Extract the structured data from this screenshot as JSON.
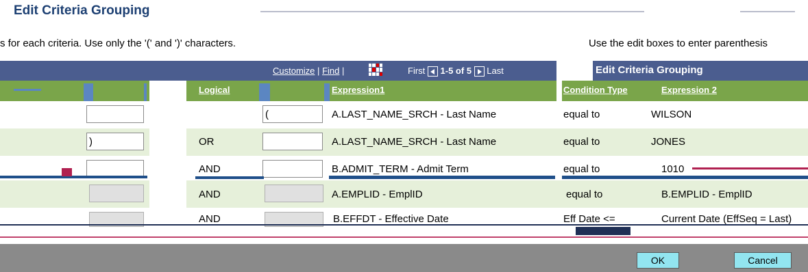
{
  "page": {
    "title": "Edit Criteria Grouping"
  },
  "instructions": {
    "left": "s for each criteria. Use only the '(' and ')' characters.",
    "right": "Use the edit boxes to enter parenthesis"
  },
  "navigation": {
    "customize_label": "Customize",
    "separator": "|",
    "find_label": "Find",
    "first_label": "First",
    "range_label": "1-5 of 5",
    "last_label": "Last"
  },
  "side_panel": {
    "title": "Edit Criteria Grouping"
  },
  "columns": {
    "logical": "Logical",
    "expression1": "Expression1",
    "condition_type": "Condition Type",
    "expression2": "Expression 2"
  },
  "rows": [
    {
      "open_paren": "",
      "logical": "",
      "close_paren": "(",
      "expression1": "A.LAST_NAME_SRCH - Last Name",
      "condition": "equal to",
      "expression2": "WILSON"
    },
    {
      "open_paren": ")",
      "logical": "OR",
      "close_paren": "",
      "expression1": "A.LAST_NAME_SRCH - Last Name",
      "condition": "equal to",
      "expression2": "JONES"
    },
    {
      "open_paren": "",
      "logical": "AND",
      "close_paren": "",
      "expression1": "B.ADMIT_TERM - Admit Term",
      "condition": "equal to",
      "expression2": "1010"
    },
    {
      "open_paren": "",
      "logical": "AND",
      "close_paren": "",
      "expression1": "A.EMPLID - EmplID",
      "condition": "equal to",
      "expression2": "B.EMPLID - EmplID"
    },
    {
      "open_paren": "",
      "logical": "AND",
      "close_paren": "",
      "expression1": "B.EFFDT - Effective Date",
      "condition": "Eff Date <=",
      "expression2": "Current Date (EffSeq = Last)"
    }
  ],
  "buttons": {
    "ok": "OK",
    "cancel": "Cancel"
  },
  "colors": {
    "header_blue": "#4b5d8f",
    "column_header_green": "#7aa54a",
    "alt_row_green": "#e6f0da",
    "button_cyan": "#92e5f0",
    "footer_gray": "#8a8a8a"
  }
}
